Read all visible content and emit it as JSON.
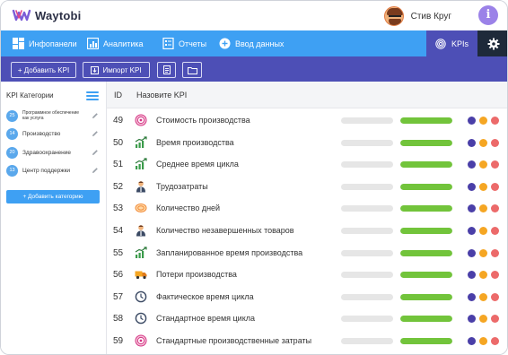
{
  "app": {
    "name": "Waytobi"
  },
  "user": {
    "name": "Стив Круг"
  },
  "info_icon": "i",
  "nav": {
    "items": [
      {
        "label": "Инфопанели",
        "icon": "dashboard-icon"
      },
      {
        "label": "Аналитика",
        "icon": "analytics-icon"
      },
      {
        "label": "Отчеты",
        "icon": "reports-icon"
      },
      {
        "label": "Ввод данных",
        "icon": "plus-circle-icon"
      }
    ],
    "kpi_tab": "KPIs",
    "settings_icon": "gear-icon"
  },
  "toolbar": {
    "add_kpi": "+ Добавить KPI",
    "import_kpi": "Импорт KPI",
    "doc_icon": "document-icon",
    "folder_icon": "folder-icon"
  },
  "sidebar": {
    "title": "KPI Категории",
    "categories": [
      {
        "count": "25",
        "label": "Программное обеспечение как услуга"
      },
      {
        "count": "14",
        "label": "Производство"
      },
      {
        "count": "20",
        "label": "Здравоохранение"
      },
      {
        "count": "13",
        "label": "Центр поддержки"
      }
    ],
    "add_button": "+ Добавить категорию"
  },
  "table": {
    "headers": {
      "id": "ID",
      "name": "Назовите KPI"
    },
    "rows": [
      {
        "id": "49",
        "name": "Стоимость производства",
        "icon": "target-icon",
        "progress": 1.0
      },
      {
        "id": "50",
        "name": "Время производства",
        "icon": "growth-chart-icon",
        "progress": 1.0
      },
      {
        "id": "51",
        "name": "Среднее время цикла",
        "icon": "growth-chart-icon",
        "progress": 1.0
      },
      {
        "id": "52",
        "name": "Трудозатраты",
        "icon": "worker-icon",
        "progress": 1.0
      },
      {
        "id": "53",
        "name": "Количество дней",
        "icon": "coin-icon",
        "progress": 1.0
      },
      {
        "id": "54",
        "name": "Количество незавершенных товаров",
        "icon": "worker-icon",
        "progress": 1.0
      },
      {
        "id": "55",
        "name": "Запланированное время производства",
        "icon": "growth-chart-icon",
        "progress": 1.0
      },
      {
        "id": "56",
        "name": "Потери производства",
        "icon": "truck-icon",
        "progress": 1.0
      },
      {
        "id": "57",
        "name": "Фактическое время цикла",
        "icon": "clock-icon",
        "progress": 1.0
      },
      {
        "id": "58",
        "name": "Стандартное время цикла",
        "icon": "clock-icon",
        "progress": 1.0
      },
      {
        "id": "59",
        "name": "Стандартные производственные затраты",
        "icon": "target-icon",
        "progress": 1.0
      }
    ],
    "status_colors": [
      "#4a3fa8",
      "#f5a623",
      "#ec6a6a"
    ]
  },
  "colors": {
    "nav_blue": "#3ea0f3",
    "purple": "#4d4fb6",
    "dark": "#1e2a3a",
    "green": "#72c43b"
  }
}
